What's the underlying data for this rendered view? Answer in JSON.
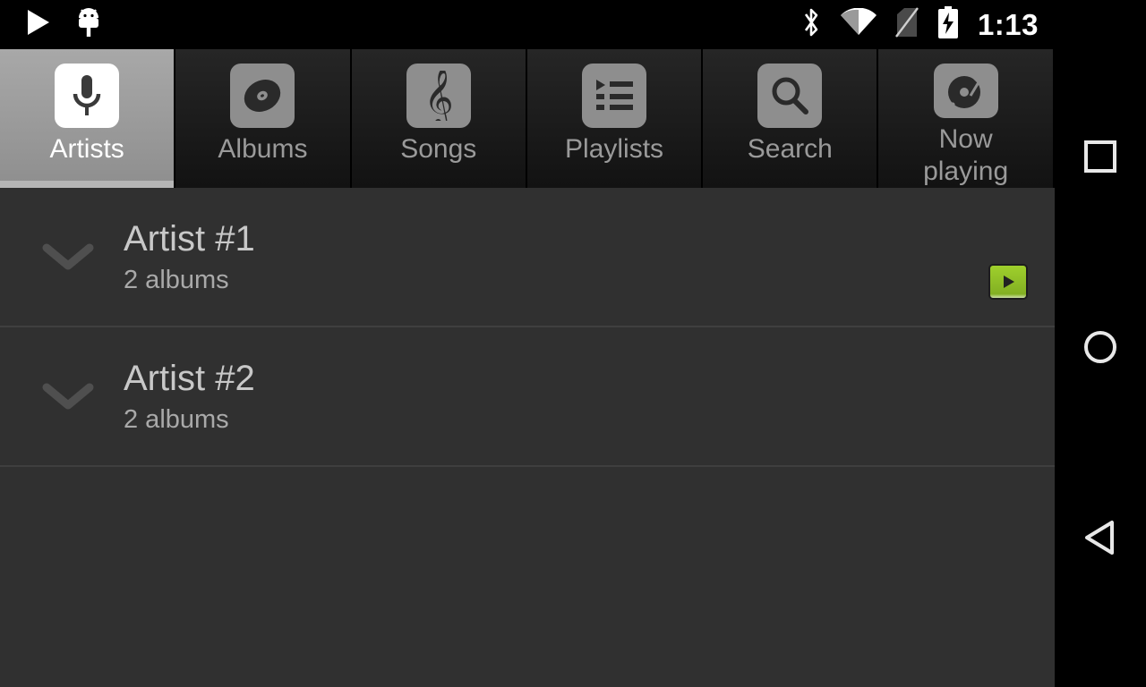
{
  "status_bar": {
    "icons": [
      {
        "name": "play-notification-icon",
        "glyph": "play"
      },
      {
        "name": "android-usb-debug-icon",
        "glyph": "android"
      }
    ],
    "right_icons": [
      {
        "name": "bluetooth-icon",
        "glyph": "bluetooth"
      },
      {
        "name": "wifi-icon",
        "glyph": "wifi"
      },
      {
        "name": "no-sim-icon",
        "glyph": "no-sim"
      },
      {
        "name": "battery-charging-icon",
        "glyph": "battery-charging"
      }
    ],
    "clock": "1:13"
  },
  "tabs": [
    {
      "label": "Artists",
      "icon": "microphone-icon",
      "selected": true,
      "clipped": false
    },
    {
      "label": "Albums",
      "icon": "vinyl-record-icon",
      "selected": false,
      "clipped": false
    },
    {
      "label": "Songs",
      "icon": "treble-clef-icon",
      "selected": false,
      "clipped": false
    },
    {
      "label": "Playlists",
      "icon": "playlist-icon",
      "selected": false,
      "clipped": false
    },
    {
      "label": "Search",
      "icon": "search-icon",
      "selected": false,
      "clipped": false
    },
    {
      "label": "Now playing",
      "icon": "turntable-icon",
      "selected": false,
      "clipped": true
    }
  ],
  "list": {
    "rows": [
      {
        "title": "Artist #1",
        "subtitle": "2 albums",
        "has_play_button": true
      },
      {
        "title": "Artist #2",
        "subtitle": "2 albums",
        "has_play_button": false
      }
    ]
  },
  "nav_bar": {
    "buttons": [
      {
        "name": "recents-button",
        "glyph": "square"
      },
      {
        "name": "home-button",
        "glyph": "circle"
      },
      {
        "name": "back-button",
        "glyph": "triangle-left"
      }
    ]
  },
  "colors": {
    "accent_play_green": "#8CC62E",
    "content_bg": "#303030",
    "tab_bg": "#1d1d1d",
    "tab_selected_bg": "#9a9a9a",
    "status_bg": "#000000",
    "title_text": "#c8c8c8",
    "subtitle_text": "#a9a9a9"
  }
}
